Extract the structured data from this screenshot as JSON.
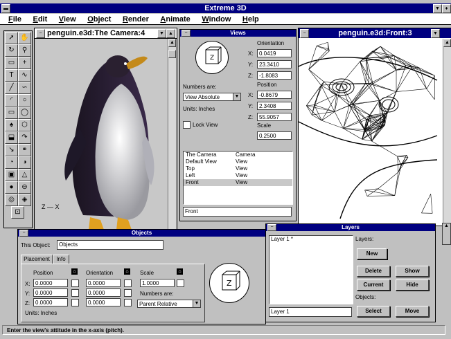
{
  "app": {
    "title": "Extreme 3D"
  },
  "menu": [
    "File",
    "Edit",
    "View",
    "Object",
    "Render",
    "Animate",
    "Window",
    "Help"
  ],
  "camera_window": {
    "title": "penguin.e3d:The Camera:4",
    "axis": "Z — X"
  },
  "front_window": {
    "title": "penguin.e3d:Front:3"
  },
  "toolbox": [
    "select-arrow",
    "hand",
    "rotate",
    "magnify",
    "marquee",
    "plus",
    "text-T",
    "freehand",
    "line",
    "curve",
    "arc",
    "circle",
    "rectangle",
    "ellipse",
    "paint",
    "polygon",
    "extrude",
    "sweep",
    "pointer",
    "link",
    "lathe",
    "skin",
    "box",
    "cone",
    "sphere",
    "cylinder",
    "torus",
    "polygon3d",
    "center"
  ],
  "views": {
    "title": "Views",
    "orientation_label": "Orientation",
    "orientation": {
      "x": "0.0419",
      "y": "23.3410",
      "z": "-1.8083"
    },
    "position_label": "Position",
    "position": {
      "x": "-0.8679",
      "y": "2.3408",
      "z": "55.9057"
    },
    "scale_label": "Scale",
    "scale": "0.2500",
    "numbers_label": "Numbers are:",
    "numbers_value": "View Absolute",
    "units": "Units:   Inches",
    "lock_view": "Lock View",
    "list": [
      {
        "name": "The Camera",
        "type": "Camera"
      },
      {
        "name": "Default View",
        "type": "View"
      },
      {
        "name": "Top",
        "type": "View"
      },
      {
        "name": "Left",
        "type": "View"
      },
      {
        "name": "Front",
        "type": "View",
        "selected": true
      }
    ],
    "name_field": "Front"
  },
  "objects": {
    "title": "Objects",
    "this_object_label": "This Object:",
    "this_object_value": "Objects",
    "tabs": [
      "Placement",
      "Info"
    ],
    "position_label": "Position",
    "orientation_label": "Orientation",
    "scale_label": "Scale",
    "position": {
      "x": "0.0000",
      "y": "0.0000",
      "z": "0.0000"
    },
    "orientation": {
      "x": "0.0000",
      "y": "0.0000",
      "z": "0.0000"
    },
    "scale": "1.0000",
    "numbers_label": "Numbers are:",
    "numbers_value": "Parent Relative",
    "units": "Units:     Inches"
  },
  "layers": {
    "title": "Layers",
    "list": [
      "Layer 1 *"
    ],
    "layers_label": "Layers:",
    "objects_label": "Objects:",
    "buttons": {
      "new": "New",
      "delete": "Delete",
      "show": "Show",
      "current": "Current",
      "hide": "Hide",
      "select": "Select",
      "move": "Move"
    },
    "name_field": "Layer 1"
  },
  "status": "Enter the view's attitude in the x-axis (pitch).",
  "colors": {
    "title_active": "#000080",
    "title_inactive": "#ffffff",
    "face": "#c0c0c0"
  }
}
